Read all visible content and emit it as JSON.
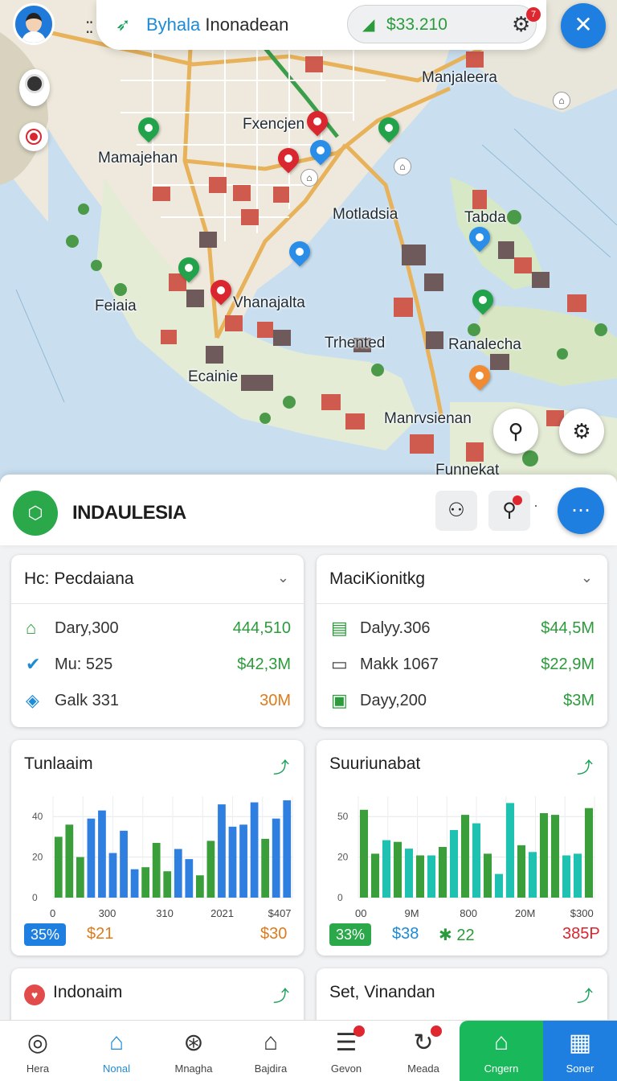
{
  "map": {
    "labels": [
      "Manjaleera",
      "Fxencjen",
      "Mamajehan",
      "Motladsia",
      "Tabda",
      "Feiaia",
      "Vhanajalta",
      "Trhented",
      "Ranalecha",
      "Ecainie",
      "Manrvsienan",
      "Funnekat"
    ]
  },
  "topbar": {
    "title_prefix": "Byhala",
    "title_main": " Inonadean",
    "balance": "$33.210",
    "badge": "7",
    "grip": "⁚⁚"
  },
  "header": {
    "region": "INDAULESIA",
    "more": "·"
  },
  "cards": {
    "left_list": {
      "title": "Hc: Pecdaiana",
      "rows": [
        {
          "label": "Dary,300",
          "value": "444,510",
          "icon": "wallet-icon",
          "color": "#2b9b3b"
        },
        {
          "label": "Mu: 525",
          "value": "$42,3M",
          "icon": "check-icon",
          "color": "#1d8bd6"
        },
        {
          "label": "Galk 331",
          "value": "30M",
          "icon": "tag-icon",
          "color": "#e07b1c"
        }
      ]
    },
    "right_list": {
      "title": "MaciKionitkg",
      "rows": [
        {
          "label": "Dalyy.306",
          "value": "$44,5M",
          "icon": "calendar-icon",
          "color": "#2b9b3b"
        },
        {
          "label": "Makk 1067",
          "value": "$22,9M",
          "icon": "card-icon",
          "color": "#2b9b3b"
        },
        {
          "label": "Dayy,200",
          "value": "$3M",
          "icon": "box-icon",
          "color": "#2b9b3b"
        }
      ]
    },
    "left_chart": {
      "title": "Tunlaaim",
      "pct": "35%",
      "m1": "$21",
      "m2": "$30"
    },
    "right_chart": {
      "title": "Suuriunabat",
      "pct": "33%",
      "m1": "$38",
      "m2": "✱ 22",
      "m3": "385P"
    },
    "left_bottom": {
      "title": "Indonaim"
    },
    "right_bottom": {
      "title": "Set, Vinandan"
    }
  },
  "chart_data": [
    {
      "type": "bar",
      "title": "Tunlaaim",
      "yticks": [
        "0",
        "20",
        "40"
      ],
      "xticks": [
        "0",
        "300",
        "310",
        "2021",
        "$407"
      ],
      "ylim": [
        0,
        50
      ],
      "colors": [
        "#3a9e3a",
        "#2f7fe0"
      ],
      "values": [
        30,
        36,
        20,
        39,
        43,
        22,
        33,
        14,
        15,
        27,
        13,
        24,
        19,
        11,
        28,
        46,
        35,
        36,
        47,
        29,
        39,
        48
      ],
      "series_index": [
        0,
        0,
        0,
        1,
        1,
        1,
        1,
        1,
        0,
        0,
        0,
        1,
        1,
        0,
        0,
        1,
        1,
        1,
        1,
        0,
        1,
        1
      ]
    },
    {
      "type": "bar",
      "title": "Suuriunabat",
      "yticks": [
        "0",
        "20",
        "50"
      ],
      "xticks": [
        "00",
        "9M",
        "800",
        "20M",
        "$300"
      ],
      "ylim": [
        0,
        60
      ],
      "colors": [
        "#3a9e3a",
        "#1fc1b0"
      ],
      "values": [
        52,
        26,
        34,
        33,
        29,
        25,
        25,
        30,
        40,
        49,
        44,
        26,
        14,
        56,
        31,
        27,
        50,
        49,
        25,
        26,
        53
      ],
      "series_index": [
        0,
        0,
        1,
        0,
        1,
        0,
        1,
        0,
        1,
        0,
        1,
        0,
        1,
        1,
        0,
        1,
        0,
        0,
        1,
        1,
        0
      ]
    }
  ],
  "nav": [
    {
      "label": "Hera",
      "icon": "target-icon",
      "glyph": "◎"
    },
    {
      "label": "Nonal",
      "icon": "home-icon",
      "glyph": "⌂"
    },
    {
      "label": "Mnagha",
      "icon": "film-icon",
      "glyph": "⊛"
    },
    {
      "label": "Bajdira",
      "icon": "building-icon",
      "glyph": "⌂"
    },
    {
      "label": "Gevon",
      "icon": "ledger-icon",
      "glyph": "☰"
    },
    {
      "label": "Meada",
      "icon": "refresh-icon",
      "glyph": "↻"
    },
    {
      "label": "Cngern",
      "icon": "house-icon",
      "glyph": "⌂"
    },
    {
      "label": "Soner",
      "icon": "grid-icon",
      "glyph": "▦"
    }
  ]
}
